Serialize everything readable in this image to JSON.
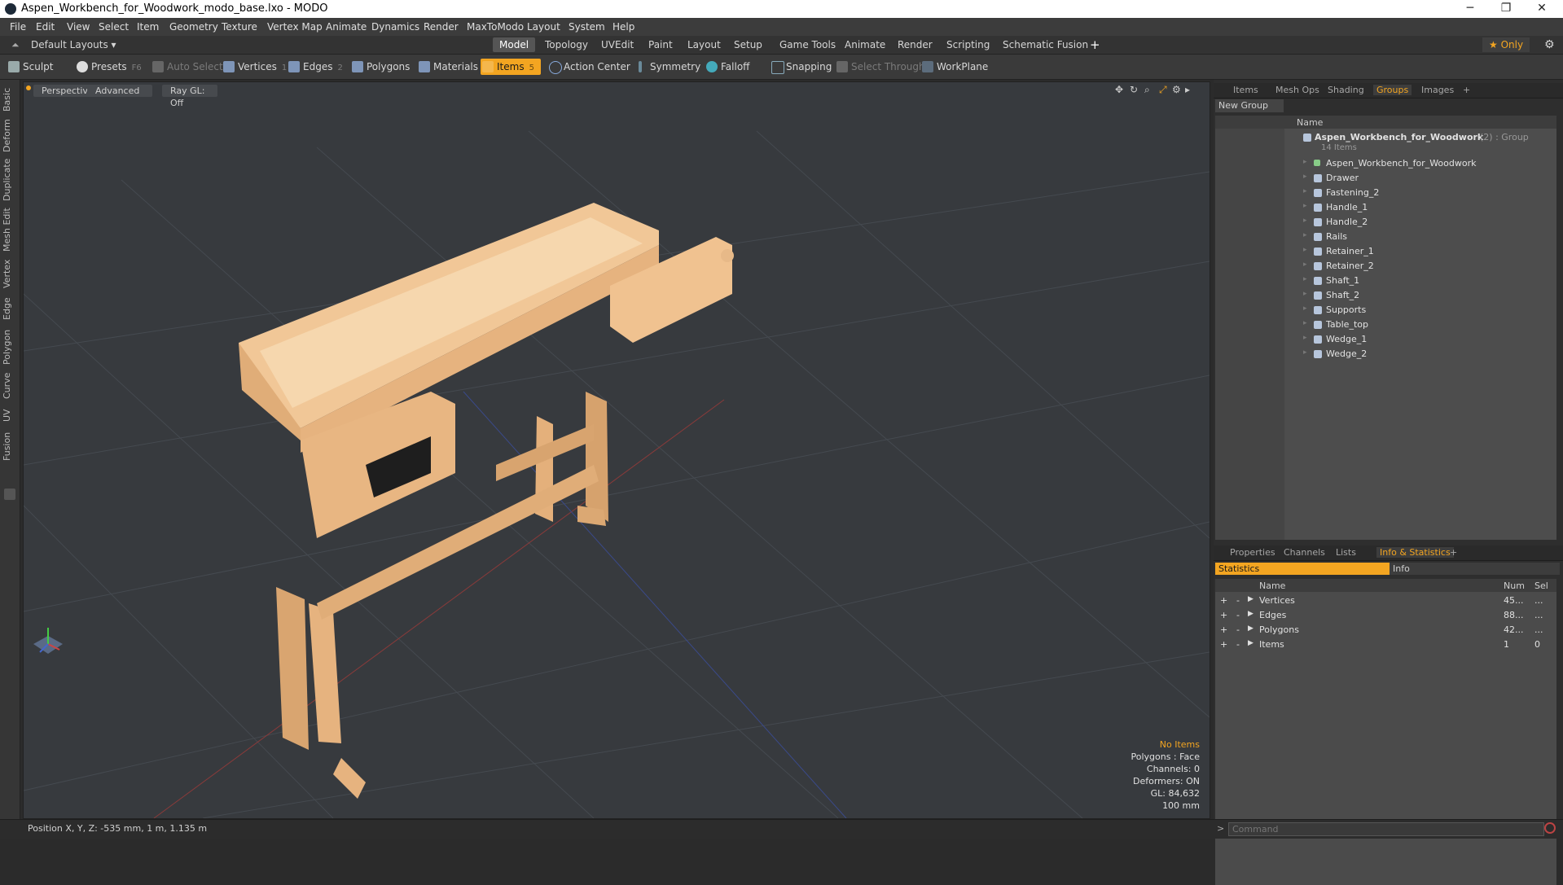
{
  "window": {
    "title": "Aspen_Workbench_for_Woodwork_modo_base.lxo - MODO",
    "controls": [
      "─",
      "❐",
      "✕"
    ]
  },
  "menu": [
    "File",
    "Edit",
    "View",
    "Select",
    "Item",
    "Geometry",
    "Texture",
    "Vertex Map",
    "Animate",
    "Dynamics",
    "Render",
    "MaxToModo",
    "Layout",
    "System",
    "Help"
  ],
  "layoutbar": {
    "layout_label": "Default Layouts ▾",
    "tabs": [
      "Model",
      "Topology",
      "UVEdit",
      "Paint",
      "Layout",
      "Setup",
      "Game Tools",
      "Animate",
      "Render",
      "Scripting",
      "Schematic Fusion"
    ],
    "active_tab": "Model",
    "add": "+",
    "only": "★  Only",
    "gear": "⚙"
  },
  "toolbar": {
    "sculpt": "Sculpt",
    "presets": "Presets",
    "presets_key": "F6",
    "auto_select": "Auto Select",
    "vertices": "Vertices",
    "vertices_key": "1",
    "edges": "Edges",
    "edges_key": "2",
    "polygons": "Polygons",
    "materials": "Materials",
    "items": "Items",
    "items_key": "5",
    "action_center": "Action Center",
    "symmetry": "Symmetry",
    "falloff": "Falloff",
    "snapping": "Snapping",
    "select_through": "Select Through",
    "workplane": "WorkPlane"
  },
  "left_tabs": [
    "Basic",
    "Deform",
    "Duplicate",
    "Mesh Edit",
    "Vertex",
    "Edge",
    "Polygon",
    "Curve",
    "UV",
    "Fusion"
  ],
  "viewport": {
    "view": "Perspective",
    "shading": "Advanced",
    "raygl": "Ray GL: Off",
    "hud": {
      "no_items": "No Items",
      "polygons": "Polygons : Face",
      "channels": "Channels: 0",
      "deformers": "Deformers: ON",
      "gl": "GL: 84,632",
      "scale": "100 mm"
    }
  },
  "groups_panel": {
    "tabs": [
      "Items",
      "Mesh Ops",
      "Shading",
      "Groups",
      "Images",
      "+"
    ],
    "active_tab": "Groups",
    "new_group": "New Group",
    "col_name": "Name",
    "group_name": "Aspen_Workbench_for_Woodwork",
    "group_suffix": "(2) : Group",
    "group_count": "14 Items",
    "items": [
      "Aspen_Workbench_for_Woodwork",
      "Drawer",
      "Fastening_2",
      "Handle_1",
      "Handle_2",
      "Rails",
      "Retainer_1",
      "Retainer_2",
      "Shaft_1",
      "Shaft_2",
      "Supports",
      "Table_top",
      "Wedge_1",
      "Wedge_2"
    ]
  },
  "info_panel": {
    "tabs": [
      "Properties",
      "Channels",
      "Lists",
      "Info & Statistics",
      "+"
    ],
    "active_tab": "Info & Statistics",
    "sub_statistics": "Statistics",
    "sub_info": "Info",
    "cols": {
      "name": "Name",
      "num": "Num",
      "sel": "Sel"
    },
    "rows": [
      {
        "name": "Vertices",
        "num": "45...",
        "sel": "..."
      },
      {
        "name": "Edges",
        "num": "88...",
        "sel": "..."
      },
      {
        "name": "Polygons",
        "num": "42...",
        "sel": "..."
      },
      {
        "name": "Items",
        "num": "1",
        "sel": "0"
      }
    ]
  },
  "status": {
    "position": "Position X, Y, Z:   -535 mm, 1 m, 1.135 m",
    "command_placeholder": "Command"
  },
  "colors": {
    "accent": "#f3a521",
    "viewport_bg": "#373a3e",
    "wood": "#e9b884"
  }
}
